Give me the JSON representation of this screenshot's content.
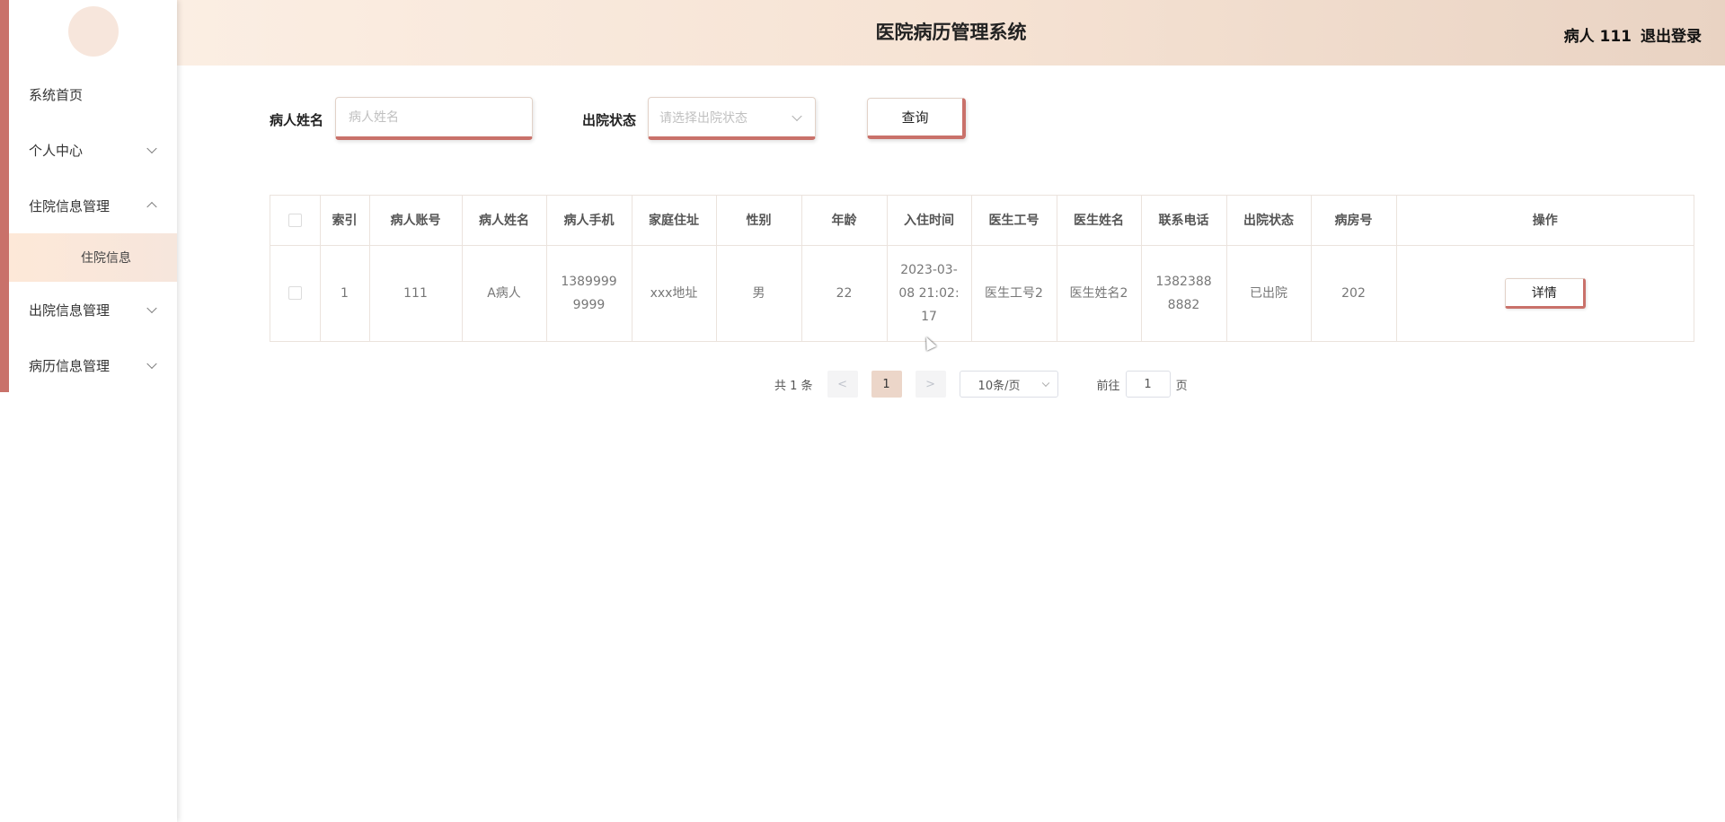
{
  "header": {
    "title": "医院病历管理系统",
    "user": "病人 111",
    "logout": "退出登录"
  },
  "sidebar": {
    "items": [
      {
        "label": "系统首页"
      },
      {
        "label": "个人中心"
      },
      {
        "label": "住院信息管理"
      },
      {
        "label": "住院信息"
      },
      {
        "label": "出院信息管理"
      },
      {
        "label": "病历信息管理"
      }
    ]
  },
  "search": {
    "name_label": "病人姓名",
    "name_placeholder": "病人姓名",
    "status_label": "出院状态",
    "status_placeholder": "请选择出院状态",
    "query_button": "查询"
  },
  "table": {
    "headers": [
      "索引",
      "病人账号",
      "病人姓名",
      "病人手机",
      "家庭住址",
      "性别",
      "年龄",
      "入住时间",
      "医生工号",
      "医生姓名",
      "联系电话",
      "出院状态",
      "病房号",
      "操作"
    ],
    "rows": [
      {
        "index": "1",
        "account": "111",
        "name": "A病人",
        "phone_line1": "1389999",
        "phone_line2": "9999",
        "address": "xxx地址",
        "gender": "男",
        "age": "22",
        "checkin_line1": "2023-03-",
        "checkin_line2": "08 21:02:",
        "checkin_line3": "17",
        "doctor_id": "医生工号2",
        "doctor_name": "医生姓名2",
        "contact_line1": "1382388",
        "contact_line2": "8882",
        "discharge_status": "已出院",
        "ward": "202",
        "action": "详情"
      }
    ]
  },
  "pagination": {
    "total": "共 1 条",
    "prev": "<",
    "current": "1",
    "next": ">",
    "page_size": "10条/页",
    "goto_label": "前往",
    "goto_value": "1",
    "goto_suffix": "页"
  },
  "colors": {
    "accent": "#c9716a",
    "header_start": "#fbeee3",
    "header_end": "#e9d3c3",
    "active_page": "#ecd6c9"
  }
}
